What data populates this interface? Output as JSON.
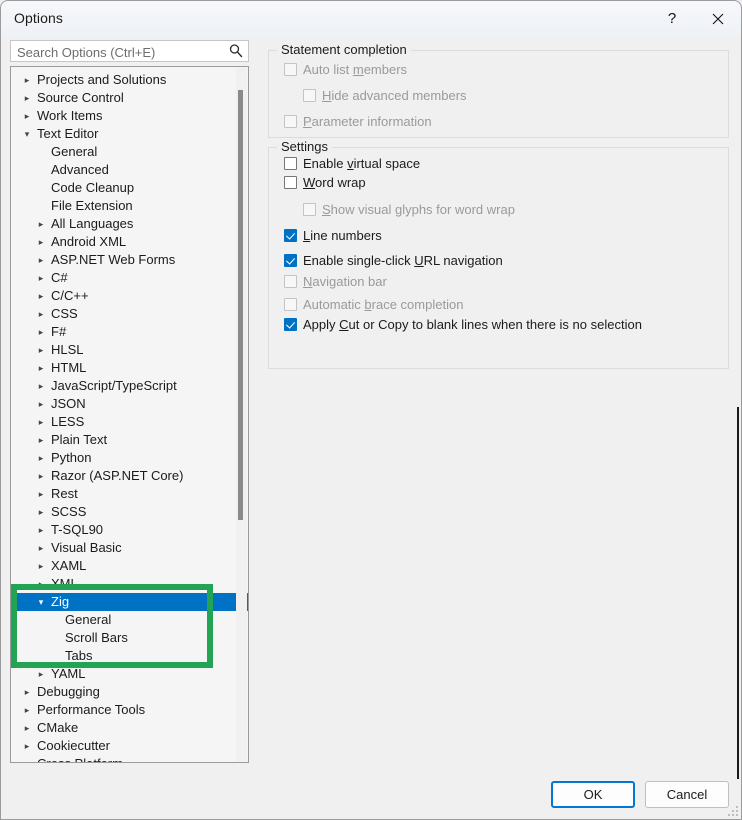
{
  "window": {
    "title": "Options",
    "help_icon": "question-mark-icon",
    "close_icon": "close-x-icon"
  },
  "search": {
    "placeholder": "Search Options (Ctrl+E)",
    "value": "",
    "icon": "magnifier-icon"
  },
  "tree": {
    "selected": "Zig",
    "items": [
      {
        "label": "Projects and Solutions",
        "indent": 0,
        "expander": "collapsed"
      },
      {
        "label": "Source Control",
        "indent": 0,
        "expander": "collapsed"
      },
      {
        "label": "Work Items",
        "indent": 0,
        "expander": "collapsed"
      },
      {
        "label": "Text Editor",
        "indent": 0,
        "expander": "expanded"
      },
      {
        "label": "General",
        "indent": 1,
        "expander": "none"
      },
      {
        "label": "Advanced",
        "indent": 1,
        "expander": "none"
      },
      {
        "label": "Code Cleanup",
        "indent": 1,
        "expander": "none"
      },
      {
        "label": "File Extension",
        "indent": 1,
        "expander": "none"
      },
      {
        "label": "All Languages",
        "indent": 1,
        "expander": "collapsed"
      },
      {
        "label": "Android XML",
        "indent": 1,
        "expander": "collapsed"
      },
      {
        "label": "ASP.NET Web Forms",
        "indent": 1,
        "expander": "collapsed"
      },
      {
        "label": "C#",
        "indent": 1,
        "expander": "collapsed"
      },
      {
        "label": "C/C++",
        "indent": 1,
        "expander": "collapsed"
      },
      {
        "label": "CSS",
        "indent": 1,
        "expander": "collapsed"
      },
      {
        "label": "F#",
        "indent": 1,
        "expander": "collapsed"
      },
      {
        "label": "HLSL",
        "indent": 1,
        "expander": "collapsed"
      },
      {
        "label": "HTML",
        "indent": 1,
        "expander": "collapsed"
      },
      {
        "label": "JavaScript/TypeScript",
        "indent": 1,
        "expander": "collapsed"
      },
      {
        "label": "JSON",
        "indent": 1,
        "expander": "collapsed"
      },
      {
        "label": "LESS",
        "indent": 1,
        "expander": "collapsed"
      },
      {
        "label": "Plain Text",
        "indent": 1,
        "expander": "collapsed"
      },
      {
        "label": "Python",
        "indent": 1,
        "expander": "collapsed"
      },
      {
        "label": "Razor (ASP.NET Core)",
        "indent": 1,
        "expander": "collapsed"
      },
      {
        "label": "Rest",
        "indent": 1,
        "expander": "collapsed"
      },
      {
        "label": "SCSS",
        "indent": 1,
        "expander": "collapsed"
      },
      {
        "label": "T-SQL90",
        "indent": 1,
        "expander": "collapsed"
      },
      {
        "label": "Visual Basic",
        "indent": 1,
        "expander": "collapsed"
      },
      {
        "label": "XAML",
        "indent": 1,
        "expander": "collapsed"
      },
      {
        "label": "XML",
        "indent": 1,
        "expander": "collapsed"
      },
      {
        "label": "Zig",
        "indent": 1,
        "expander": "expanded",
        "selected": true
      },
      {
        "label": "General",
        "indent": 2,
        "expander": "none"
      },
      {
        "label": "Scroll Bars",
        "indent": 2,
        "expander": "none"
      },
      {
        "label": "Tabs",
        "indent": 2,
        "expander": "none"
      },
      {
        "label": "YAML",
        "indent": 1,
        "expander": "collapsed"
      },
      {
        "label": "Debugging",
        "indent": 0,
        "expander": "collapsed"
      },
      {
        "label": "Performance Tools",
        "indent": 0,
        "expander": "collapsed"
      },
      {
        "label": "CMake",
        "indent": 0,
        "expander": "collapsed"
      },
      {
        "label": "Cookiecutter",
        "indent": 0,
        "expander": "collapsed"
      },
      {
        "label": "Cross Platform",
        "indent": 0,
        "expander": "collapsed"
      }
    ]
  },
  "panel": {
    "statement_completion": {
      "title": "Statement completion",
      "options": [
        {
          "label": "Auto list members",
          "accel": "m",
          "checked": false,
          "disabled": true,
          "indent": 0
        },
        {
          "label": "Hide advanced members",
          "accel": "H",
          "checked": false,
          "disabled": true,
          "indent": 1
        },
        {
          "label": "Parameter information",
          "accel": "P",
          "checked": false,
          "disabled": true,
          "indent": 0
        }
      ]
    },
    "settings": {
      "title": "Settings",
      "options": [
        {
          "label": "Enable virtual space",
          "accel": "v",
          "checked": false,
          "disabled": false,
          "indent": 0
        },
        {
          "label": "Word wrap",
          "accel": "W",
          "checked": false,
          "disabled": false,
          "indent": 0
        },
        {
          "label": "Show visual glyphs for word wrap",
          "accel": "S",
          "checked": false,
          "disabled": true,
          "indent": 1
        },
        {
          "label": "Line numbers",
          "accel": "L",
          "checked": true,
          "disabled": false,
          "indent": 0
        },
        {
          "label": "Enable single-click URL navigation",
          "accel": "U",
          "checked": true,
          "disabled": false,
          "indent": 0
        },
        {
          "label": "Navigation bar",
          "accel": "N",
          "checked": false,
          "disabled": true,
          "indent": 0
        },
        {
          "label": "Automatic brace completion",
          "accel": "b",
          "checked": false,
          "disabled": true,
          "indent": 0
        },
        {
          "label": "Apply Cut or Copy to blank lines when there is no selection",
          "accel": "C",
          "checked": true,
          "disabled": false,
          "indent": 0
        }
      ]
    }
  },
  "footer": {
    "ok_label": "OK",
    "cancel_label": "Cancel"
  },
  "annotation": {
    "color": "#23a455",
    "target": "Zig"
  }
}
